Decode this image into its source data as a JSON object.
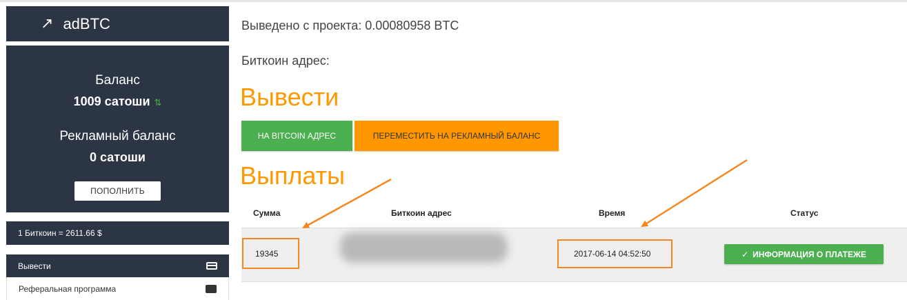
{
  "app": {
    "brand": "adBTC"
  },
  "sidebar": {
    "balance_label": "Баланс",
    "balance_value": "1009 сатоши",
    "ad_balance_label": "Рекламный баланс",
    "ad_balance_value": "0 сатоши",
    "topup_label": "ПОПОЛНИТЬ",
    "rate": "1 Биткоин = 2611.66 $",
    "menu": [
      {
        "label": "Вывести",
        "icon": "credit-card-icon",
        "active": true
      },
      {
        "label": "Реферальная программа",
        "icon": "people-icon",
        "active": false
      }
    ]
  },
  "main": {
    "withdrawn": "Выведено с проекта: 0.00080958 BTC",
    "btc_address_label": "Биткоин адрес:",
    "withdraw_title": "Вывести",
    "btn_to_bitcoin": "НА BITCOIN АДРЕС",
    "btn_to_ad_balance": "ПЕРЕМЕСТИТЬ НА РЕКЛАМНЫЙ БАЛАНС",
    "payouts_title": "Выплаты",
    "table": {
      "headers": [
        "Сумма",
        "Биткоин адрес",
        "Время",
        "Статус"
      ],
      "rows": [
        {
          "sum": "19345",
          "address": "",
          "time": "2017-06-14 04:52:50",
          "status_label": "ИНФОРМАЦИЯ О ПЛАТЕЖЕ"
        }
      ]
    }
  },
  "colors": {
    "sidebar_bg": "#2c3544",
    "accent_orange": "#ff9800",
    "green": "#4caf50",
    "annotation": "#f5871f"
  }
}
